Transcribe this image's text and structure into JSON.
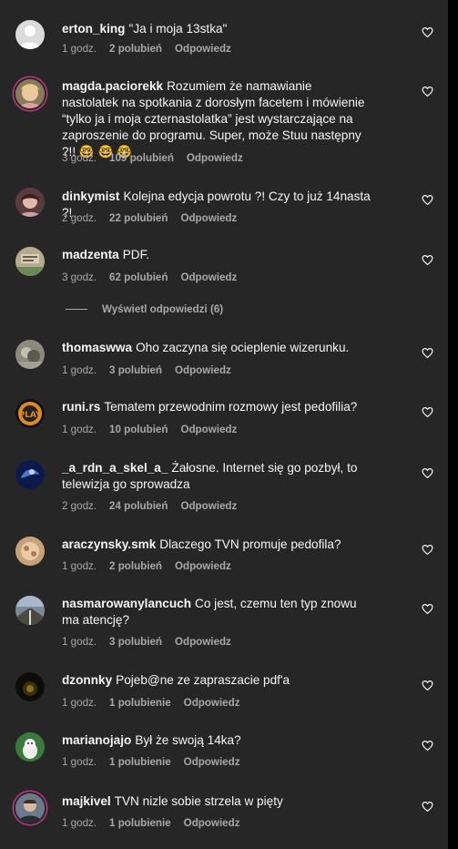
{
  "comments": [
    {
      "username": "erton_king",
      "text": "\"Ja i moja 13stka\"",
      "time": "1 godz.",
      "likes": "2 polubień",
      "reply": "Odpowiedz",
      "avatar": "default-avatar"
    },
    {
      "username": "magda.paciorekk",
      "text": "Rozumiem że namawianie nastolatek na spotkania z dorosłym facetem i mówienie “tylko ja i moja czternastolatka” jest wystarczające na zaproszenie do programu. Super, może Stuu następny ?!! 🤓 🤓 🤓",
      "time": "3 godz.",
      "likes": "109 polubień",
      "reply": "Odpowiedz",
      "avatar": "photo-blonde"
    },
    {
      "username": "dinkymist",
      "text": "Kolejna edycja powrotu ?! Czy to już 14nasta ?!",
      "time": "2 godz.",
      "likes": "22 polubień",
      "reply": "Odpowiedz",
      "avatar": "photo-woman"
    },
    {
      "username": "madzenta",
      "text": "PDF.",
      "time": "3 godz.",
      "likes": "62 polubień",
      "reply": "Odpowiedz",
      "avatar": "photo-sign"
    },
    {
      "username": "thomaswwa",
      "text": "Oho zaczyna się ocieplenie wizerunku.",
      "time": "1 godz.",
      "likes": "3 polubień",
      "reply": "Odpowiedz",
      "avatar": "photo-grey"
    },
    {
      "username": "runi.rs",
      "text": "Tematem przewodnim rozmowy jest pedofilia?",
      "time": "1 godz.",
      "likes": "10 polubień",
      "reply": "Odpowiedz",
      "avatar": "play-logo"
    },
    {
      "username": "_a_rdn_a_skel_a_",
      "text": "Żałosne. Internet się go pozbył, to telewizja go sprowadza",
      "time": "2 godz.",
      "likes": "24 polubień",
      "reply": "Odpowiedz",
      "avatar": "photo-blue"
    },
    {
      "username": "araczynsky.smk",
      "text": "Dlaczego TVN promuje pedofila?",
      "time": "1 godz.",
      "likes": "2 polubień",
      "reply": "Odpowiedz",
      "avatar": "photo-sand"
    },
    {
      "username": "nasmarowanylancuch",
      "text": "Co jest, czemu ten typ znowu ma atencję?",
      "time": "1 godz.",
      "likes": "3 polubień",
      "reply": "Odpowiedz",
      "avatar": "photo-road"
    },
    {
      "username": "dzonnky",
      "text": "Pojeb@ne ze zapraszacie pdf'a",
      "time": "1 godz.",
      "likes": "1 polubienie",
      "reply": "Odpowiedz",
      "avatar": "photo-dark"
    },
    {
      "username": "marianojajo",
      "text": "Był że swoją 14ka?",
      "time": "1 godz.",
      "likes": "1 polubienie",
      "reply": "Odpowiedz",
      "avatar": "photo-dog"
    },
    {
      "username": "majkivel",
      "text": "TVN nizle sobie strzela w pięty",
      "time": "1 godz.",
      "likes": "1 polubienie",
      "reply": "Odpowiedz",
      "avatar": "photo-man"
    }
  ],
  "view_replies": "Wyświetl odpowiedzi (6)",
  "colors": {
    "background": "#262626",
    "text": "#f5f5f5",
    "secondary": "#a8a8a8",
    "story_ring": "#c13584"
  }
}
